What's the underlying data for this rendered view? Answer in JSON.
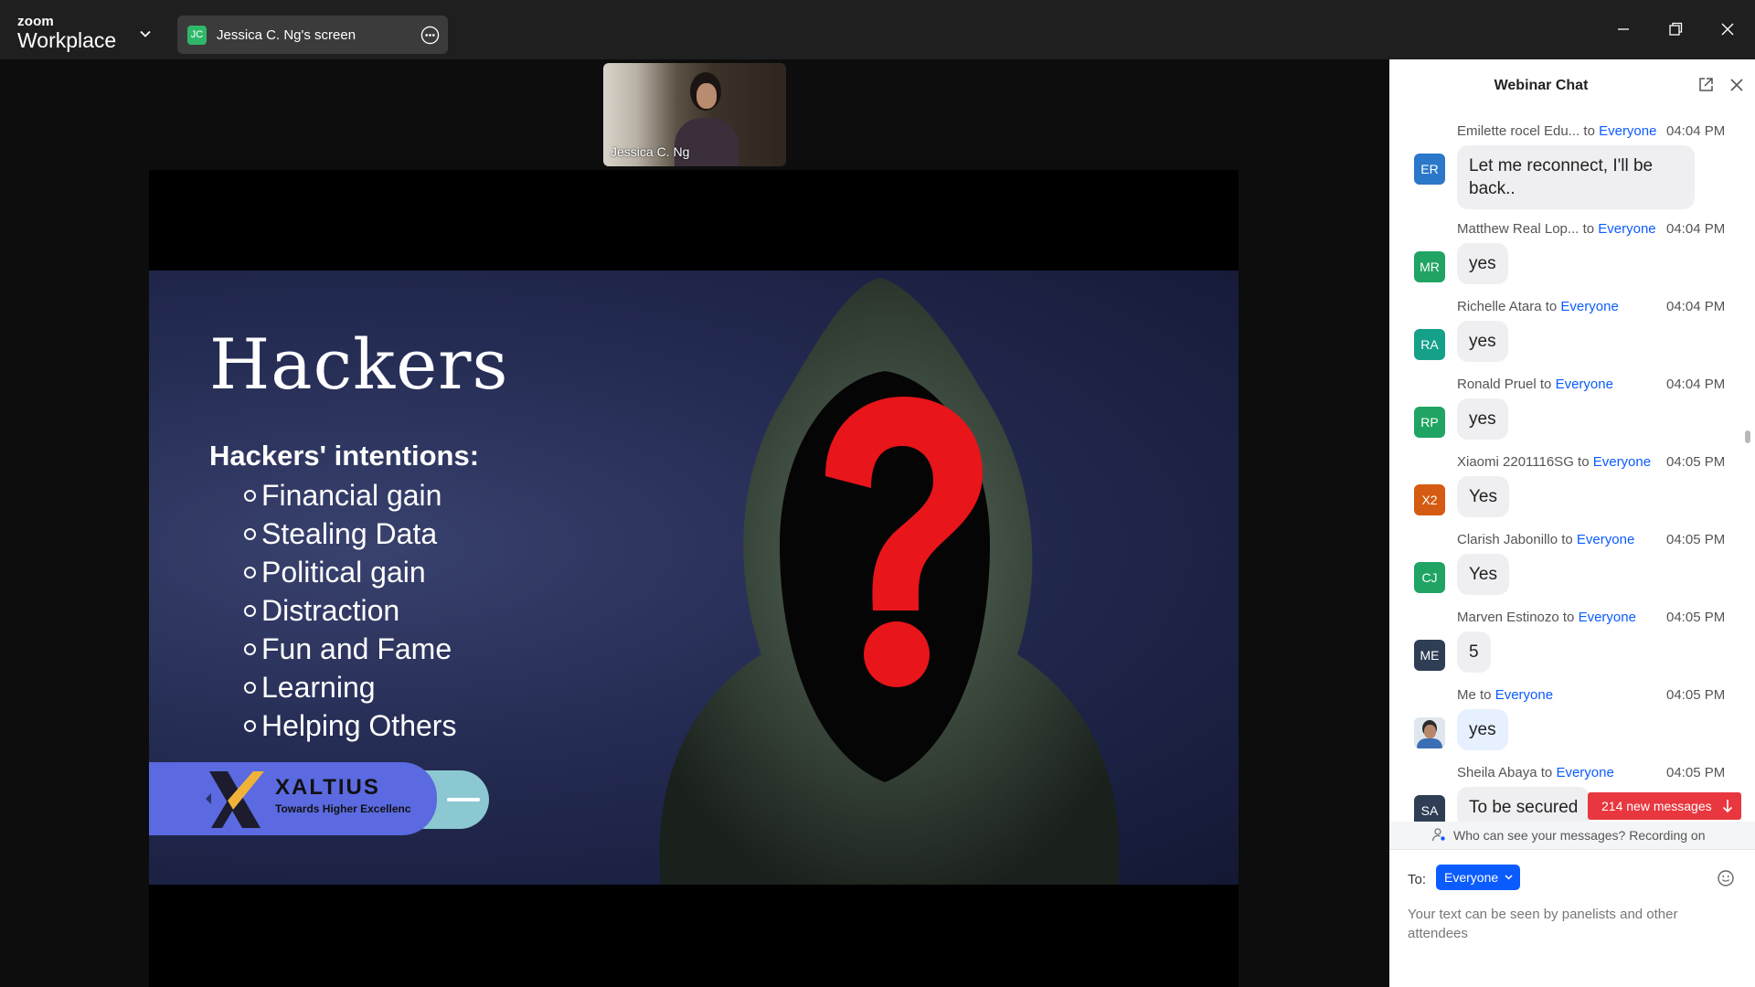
{
  "app": {
    "brand_small": "zoom",
    "brand_big": "Workplace"
  },
  "share_pill": {
    "initials": "JC",
    "label": "Jessica C. Ng's screen"
  },
  "video": {
    "name": "Jessica C. Ng"
  },
  "slide": {
    "title": "Hackers",
    "subtitle": "Hackers' intentions:",
    "items": [
      "Financial gain",
      "Stealing Data",
      "Political gain",
      "Distraction",
      "Fun and Fame",
      "Learning",
      "Helping Others"
    ],
    "brand_name": "XALTIUS",
    "brand_tagline": "Towards Higher Excellenc"
  },
  "chat": {
    "title": "Webinar Chat",
    "messages": [
      {
        "initials": "ER",
        "color": "#2b77c9",
        "sender": "Emilette rocel Edu...",
        "to_prefix": " to ",
        "to": "Everyone",
        "time": "04:04 PM",
        "text": "Let me reconnect, I'll be back.."
      },
      {
        "initials": "MR",
        "color": "#1fa463",
        "sender": "Matthew Real Lop...",
        "to_prefix": " to ",
        "to": "Everyone",
        "time": "04:04 PM",
        "text": "yes"
      },
      {
        "initials": "RA",
        "color": "#15a08a",
        "sender": "Richelle Atara",
        "to_prefix": " to ",
        "to": "Everyone",
        "time": "04:04 PM",
        "text": "yes"
      },
      {
        "initials": "RP",
        "color": "#1fa463",
        "sender": "Ronald Pruel",
        "to_prefix": " to ",
        "to": "Everyone",
        "time": "04:04 PM",
        "text": "yes"
      },
      {
        "initials": "X2",
        "color": "#d55a12",
        "sender": "Xiaomi 2201116SG",
        "to_prefix": " to ",
        "to": "Everyone",
        "time": "04:05 PM",
        "text": "Yes"
      },
      {
        "initials": "CJ",
        "color": "#1fa463",
        "sender": "Clarish Jabonillo",
        "to_prefix": " to ",
        "to": "Everyone",
        "time": "04:05 PM",
        "text": "Yes"
      },
      {
        "initials": "ME",
        "color": "#2f3e55",
        "sender": "Marven Estinozo",
        "to_prefix": " to ",
        "to": "Everyone",
        "time": "04:05 PM",
        "text": "5"
      },
      {
        "initials": "",
        "color": "#dfe6ee",
        "sender": "Me",
        "to_prefix": " to ",
        "to": "Everyone",
        "time": "04:05 PM",
        "text": "yes"
      },
      {
        "initials": "SA",
        "color": "#2f3e55",
        "sender": "Sheila Abaya",
        "to_prefix": " to ",
        "to": "Everyone",
        "time": "04:05 PM",
        "text": "To be secured"
      }
    ],
    "new_messages": "214 new messages",
    "privacy": "Who can see your messages? Recording on",
    "to_label": "To:",
    "to_value": "Everyone",
    "placeholder": "Your text can be seen by panelists and other attendees"
  }
}
